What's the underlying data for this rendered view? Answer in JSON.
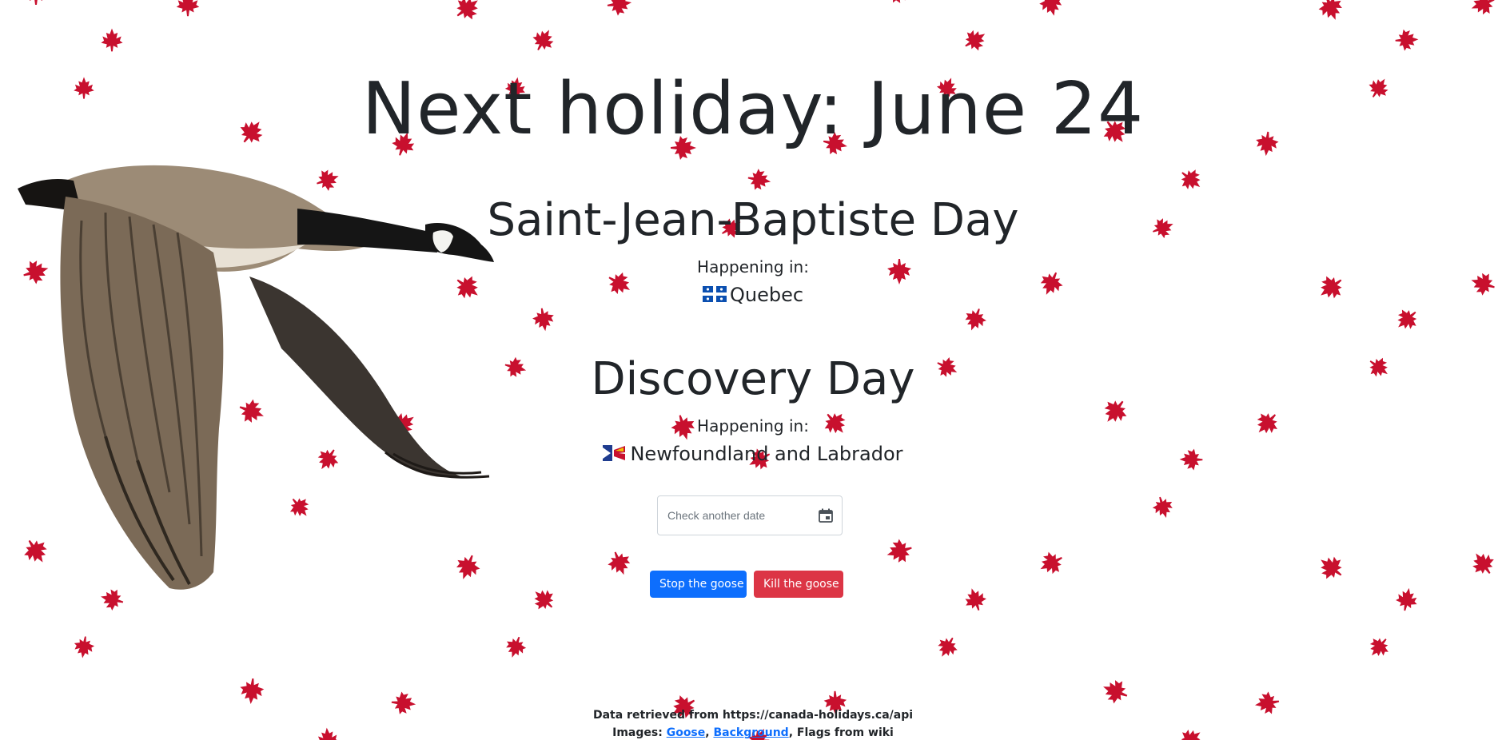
{
  "colors": {
    "leaf": "#c8102e",
    "primary_button": "#0d6efd",
    "danger_button": "#dc3545",
    "text": "#212529"
  },
  "headline": "Next holiday: June 24",
  "holidays": [
    {
      "name": "Saint-Jean-Baptiste Day",
      "happening_label": "Happening in:",
      "province": "Quebec",
      "flag_icon": "quebec-flag-icon"
    },
    {
      "name": "Discovery Day",
      "happening_label": "Happening in:",
      "province": "Newfoundland and Labrador",
      "flag_icon": "newfoundland-flag-icon"
    }
  ],
  "date_picker": {
    "placeholder": "Check another date",
    "icon": "calendar-icon"
  },
  "buttons": {
    "stop": "Stop the goose",
    "kill": "Kill the goose"
  },
  "footer": {
    "data_source": "Data retrieved from https://canada-holidays.ca/api",
    "images_prefix": "Images: ",
    "goose_link": "Goose",
    "separator": ", ",
    "background_link": "Background",
    "flags_text": ", Flags from wiki"
  }
}
